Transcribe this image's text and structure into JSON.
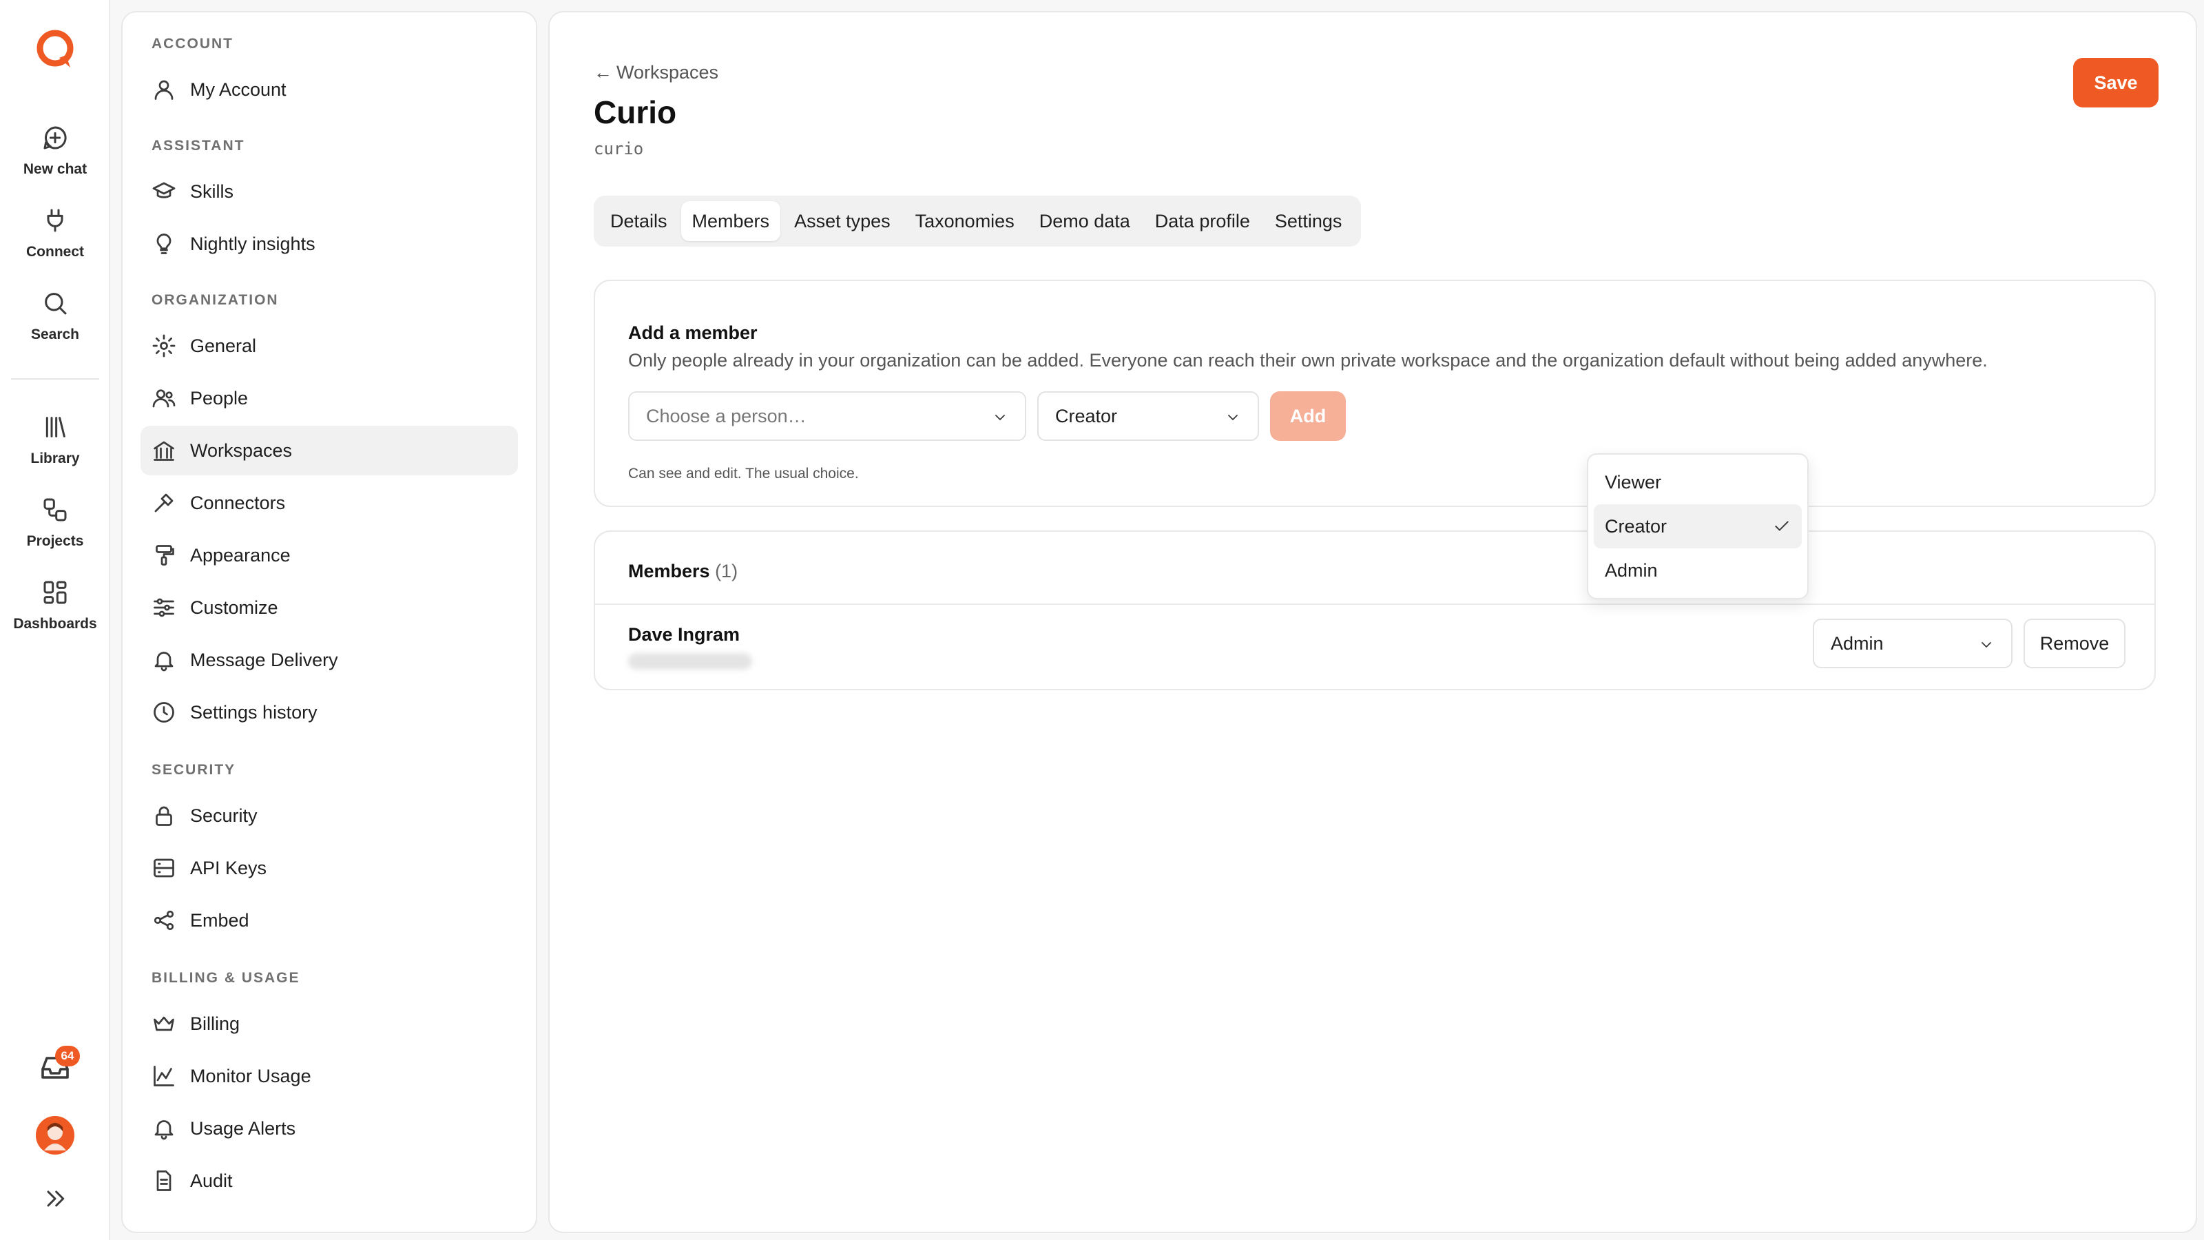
{
  "rail": {
    "items": [
      {
        "label": "New chat",
        "icon": "new-chat-icon"
      },
      {
        "label": "Connect",
        "icon": "plug-icon"
      },
      {
        "label": "Search",
        "icon": "search-icon"
      },
      {
        "label": "Library",
        "icon": "library-icon"
      },
      {
        "label": "Projects",
        "icon": "projects-icon"
      },
      {
        "label": "Dashboards",
        "icon": "dashboards-icon"
      }
    ],
    "inbox_badge": "64"
  },
  "sidebar": {
    "sections": {
      "account": "ACCOUNT",
      "assistant": "ASSISTANT",
      "organization": "ORGANIZATION",
      "security": "SECURITY",
      "billing": "BILLING & USAGE"
    },
    "items": {
      "my_account": "My Account",
      "skills": "Skills",
      "nightly_insights": "Nightly insights",
      "general": "General",
      "people": "People",
      "workspaces": "Workspaces",
      "connectors": "Connectors",
      "appearance": "Appearance",
      "customize": "Customize",
      "message_delivery": "Message Delivery",
      "settings_history": "Settings history",
      "security": "Security",
      "api_keys": "API Keys",
      "embed": "Embed",
      "billing": "Billing",
      "monitor_usage": "Monitor Usage",
      "usage_alerts": "Usage Alerts",
      "audit": "Audit"
    },
    "active": "Workspaces"
  },
  "main": {
    "back_arrow": "←",
    "back_label": "Workspaces",
    "title": "Curio",
    "slug": "curio",
    "save_label": "Save",
    "tabs": [
      "Details",
      "Members",
      "Asset types",
      "Taxonomies",
      "Demo data",
      "Data profile",
      "Settings"
    ],
    "active_tab": "Members",
    "add_member": {
      "title": "Add a member",
      "description": "Only people already in your organization can be added. Everyone can reach their own private workspace and the organization default without being added anywhere.",
      "person_placeholder": "Choose a person…",
      "role_value": "Creator",
      "add_label": "Add",
      "role_hint": "Can see and edit. The usual choice."
    },
    "role_dropdown": {
      "options": [
        "Viewer",
        "Creator",
        "Admin"
      ],
      "selected": "Creator"
    },
    "members": {
      "title": "Members",
      "count": "(1)",
      "rows": [
        {
          "name": "Dave Ingram",
          "role": "Admin",
          "remove_label": "Remove"
        }
      ]
    }
  },
  "colors": {
    "accent": "#ef5a24",
    "accent_disabled": "#f6b097"
  }
}
